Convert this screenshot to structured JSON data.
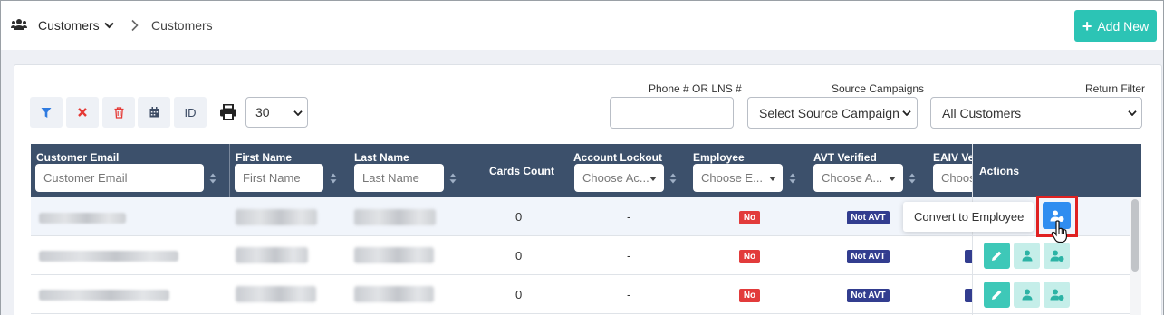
{
  "breadcrumb": {
    "section_icon": "users-icon",
    "section": "Customers",
    "current": "Customers"
  },
  "header": {
    "add_new_label": "Add New",
    "accent": "#2cc4b5"
  },
  "toolbar": {
    "id_label": "ID",
    "per_page": "30"
  },
  "filters": {
    "phone_label": "Phone # OR LNS #",
    "phone_value": "",
    "source_label": "Source Campaigns",
    "source_value": "Select Source Campaign",
    "return_label": "Return Filter",
    "return_value": "All Customers"
  },
  "table": {
    "columns": {
      "email": {
        "label": "Customer Email",
        "placeholder": "Customer Email"
      },
      "first_name": {
        "label": "First Name",
        "placeholder": "First Name"
      },
      "last_name": {
        "label": "Last Name",
        "placeholder": "Last Name"
      },
      "cards_count": {
        "label": "Cards Count"
      },
      "account_lockout": {
        "label": "Account Lockout",
        "placeholder": "Choose Ac..."
      },
      "employee": {
        "label": "Employee",
        "placeholder": "Choose E..."
      },
      "avt_verified": {
        "label": "AVT Verified",
        "placeholder": "Choose A..."
      },
      "eaiv_verified": {
        "label": "EAIV Ver",
        "placeholder": "Choos"
      },
      "actions": {
        "label": "Actions"
      }
    },
    "rows": [
      {
        "cards_count": "0",
        "account_lockout": "-",
        "employee": "No",
        "avt": "Not AVT"
      },
      {
        "cards_count": "0",
        "account_lockout": "-",
        "employee": "No",
        "avt": "Not AVT"
      },
      {
        "cards_count": "0",
        "account_lockout": "-",
        "employee": "No",
        "avt": "Not AVT"
      }
    ],
    "colors": {
      "header_bg": "#3c506b",
      "badge_no": "#e23b3b",
      "badge_avt": "#323d8f"
    }
  },
  "tooltip": {
    "text": "Convert to Employee"
  }
}
